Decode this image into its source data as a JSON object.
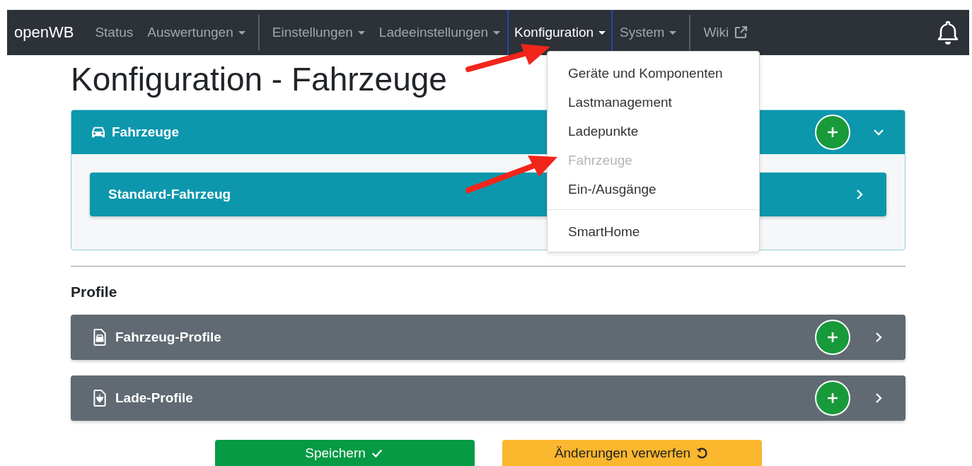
{
  "navbar": {
    "brand": "openWB",
    "items": [
      {
        "kind": "link",
        "label": "Status",
        "dropdown": false,
        "external": false,
        "selected": false
      },
      {
        "kind": "link",
        "label": "Auswertungen",
        "dropdown": true,
        "external": false,
        "selected": false
      },
      {
        "kind": "divider"
      },
      {
        "kind": "link",
        "label": "Einstellungen",
        "dropdown": true,
        "external": false,
        "selected": false
      },
      {
        "kind": "link",
        "label": "Ladeeinstellungen",
        "dropdown": true,
        "external": false,
        "selected": false
      },
      {
        "kind": "link",
        "label": "Konfiguration",
        "dropdown": true,
        "external": false,
        "selected": true
      },
      {
        "kind": "link",
        "label": "System",
        "dropdown": true,
        "external": false,
        "selected": false
      },
      {
        "kind": "divider"
      },
      {
        "kind": "link",
        "label": "Wiki",
        "dropdown": false,
        "external": true,
        "selected": false
      }
    ]
  },
  "dropdown_menu": {
    "items": [
      {
        "kind": "item",
        "label": "Geräte und Komponenten",
        "disabled": false
      },
      {
        "kind": "item",
        "label": "Lastmanagement",
        "disabled": false
      },
      {
        "kind": "item",
        "label": "Ladepunkte",
        "disabled": false
      },
      {
        "kind": "item",
        "label": "Fahrzeuge",
        "disabled": true
      },
      {
        "kind": "item",
        "label": "Ein-/Ausgänge",
        "disabled": false
      },
      {
        "kind": "divider"
      },
      {
        "kind": "item",
        "label": "SmartHome",
        "disabled": false
      }
    ]
  },
  "page_title": "Konfiguration - Fahrzeuge",
  "vehicles_card": {
    "title": "Fahrzeuge",
    "expanded": true,
    "items": [
      {
        "name": "Standard-Fahrzeug"
      }
    ]
  },
  "profile_section": {
    "heading": "Profile",
    "panels": [
      {
        "title": "Fahrzeug-Profile",
        "kind": "vehicle-profile"
      },
      {
        "title": "Lade-Profile",
        "kind": "charge-profile"
      }
    ]
  },
  "buttons": [
    {
      "label": "Speichern",
      "kind": "save"
    },
    {
      "label": "Änderungen verwerfen",
      "kind": "discard"
    }
  ]
}
